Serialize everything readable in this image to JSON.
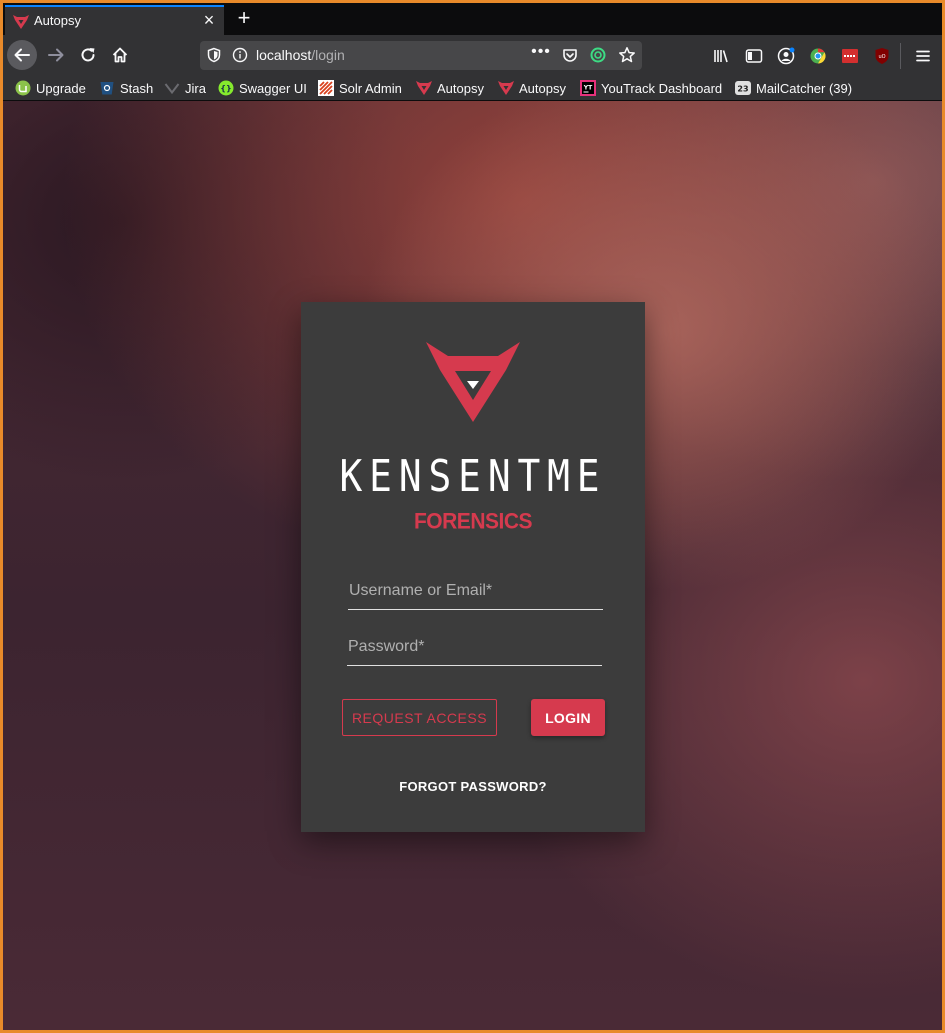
{
  "tab": {
    "title": "Autopsy",
    "close_glyph": "×",
    "new_tab_glyph": "+"
  },
  "url": {
    "host": "localhost",
    "path": "/login",
    "more_glyph": "•••"
  },
  "bookmarks": [
    {
      "label": "Upgrade",
      "icon": "mint-icon"
    },
    {
      "label": "Stash",
      "icon": "stash-icon"
    },
    {
      "label": "Jira",
      "icon": "jira-icon"
    },
    {
      "label": "Swagger UI",
      "icon": "swagger-icon"
    },
    {
      "label": "Solr Admin",
      "icon": "solr-icon"
    },
    {
      "label": "Autopsy",
      "icon": "autopsy-icon"
    },
    {
      "label": "Autopsy",
      "icon": "autopsy-icon"
    },
    {
      "label": "YouTrack Dashboard",
      "icon": "youtrack-icon"
    },
    {
      "label": "MailCatcher (39)",
      "icon": "mailcatcher-icon"
    }
  ],
  "login": {
    "brand": "KENSENTME",
    "subtitle": "FORENSICS",
    "username_placeholder": "Username or Email*",
    "password_placeholder": "Password*",
    "request_access_label": "REQUEST ACCESS",
    "login_label": "LOGIN",
    "forgot_label": "FORGOT PASSWORD?"
  },
  "colors": {
    "accent": "#d63a4e",
    "card": "#3c3c3c",
    "chrome": "#323234",
    "tabstrip": "#0c0c0d",
    "window_frame": "#e88a2a"
  }
}
